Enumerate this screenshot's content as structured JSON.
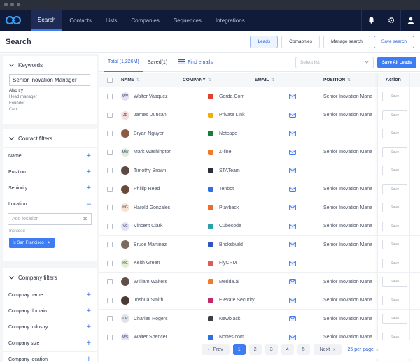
{
  "nav": {
    "tabs": [
      "Search",
      "Contacts",
      "Lists",
      "Companies",
      "Sequences",
      "Integrations"
    ],
    "active": "Search"
  },
  "header": {
    "title": "Search",
    "buttons": [
      "Leads",
      "Comapnies",
      "Manage search",
      "Save search"
    ]
  },
  "sidebar": {
    "keywords": {
      "title": "Keywords",
      "value": "Senior Inovation Manager",
      "also_try_label": "Also try",
      "suggestions": [
        "Head manager",
        "Founder",
        "Ceo"
      ]
    },
    "contact_filters": {
      "title": "Contact filters",
      "items": [
        "Name",
        "Position",
        "Seniority",
        "Location"
      ],
      "location_placeholder": "Add location",
      "included_label": "Included",
      "chip": "Is San Francisco"
    },
    "company_filters": {
      "title": "Company filters",
      "items": [
        "Compnay name",
        "Company domain",
        "Company industry",
        "Company size",
        "Company location"
      ]
    }
  },
  "main": {
    "tabs": [
      "Total (1,226M)",
      "Saved(1)"
    ],
    "find_emails": "Find emails",
    "select_placeholder": "Select list",
    "save_all": "Save All Leads",
    "columns": [
      "NAME",
      "COMPANY",
      "EMAIL",
      "POSITION",
      "Action"
    ],
    "save_label": "Save",
    "rows": [
      {
        "name": "Walter Vasquez",
        "initials": "WV",
        "avatar_color": "#e3e1f6",
        "company": "Gorda Com",
        "logo_color": "#e0412f",
        "email": true,
        "position": "Senior Inovation Mana"
      },
      {
        "name": "James Duncan",
        "initials": "JD",
        "avatar_color": "#f7dcdc",
        "company": "Private Link",
        "logo_color": "#f0b000",
        "email": true,
        "position": "Senior Inovation Mana"
      },
      {
        "name": "Bryan Nguyen",
        "initials": "",
        "avatar_color": "#8a5a44",
        "company": "Netcape",
        "logo_color": "#1a7a3a",
        "email": true,
        "position": ""
      },
      {
        "name": "Mark Washington",
        "initials": "MW",
        "avatar_color": "#dcefd6",
        "company": "Z-line",
        "logo_color": "#f07a2a",
        "email": true,
        "position": "Senior Inovation Mana"
      },
      {
        "name": "Timothy Brown",
        "initials": "",
        "avatar_color": "#5a4a42",
        "company": "STATeam",
        "logo_color": "#2a2f3a",
        "email": true,
        "position": ""
      },
      {
        "name": "Phillip Reed",
        "initials": "",
        "avatar_color": "#6b4a3a",
        "company": "Tenbot",
        "logo_color": "#2f6fe0",
        "email": true,
        "position": "Senior Inovation Mana"
      },
      {
        "name": "Harold Gonzales",
        "initials": "HG",
        "avatar_color": "#f6e2cf",
        "company": "Playback",
        "logo_color": "#f06a2a",
        "email": true,
        "position": "Senior Inovation Mana"
      },
      {
        "name": "Vincent Clark",
        "initials": "VC",
        "avatar_color": "#e3e1f6",
        "company": "Cubecode",
        "logo_color": "#2aa0a8",
        "email": true,
        "position": "Senior Inovation Mana"
      },
      {
        "name": "Bruce Martinez",
        "initials": "",
        "avatar_color": "#7a6a60",
        "company": "Bricksbuild",
        "logo_color": "#2f55c0",
        "email": true,
        "position": "Senior Inovation Mana"
      },
      {
        "name": "Keith Green",
        "initials": "KG",
        "avatar_color": "#e4efd2",
        "company": "FlyCRM",
        "logo_color": "#e05a5a",
        "email": true,
        "position": ""
      },
      {
        "name": "William Walters",
        "initials": "",
        "avatar_color": "#5f4f48",
        "company": "Merida.ai",
        "logo_color": "#f07a2a",
        "email": true,
        "position": "Senior Inovation Mana"
      },
      {
        "name": "Joshua Smith",
        "initials": "",
        "avatar_color": "#4a3a36",
        "company": "Elevate Security",
        "logo_color": "#c02a6a",
        "email": true,
        "position": "Senior Inovation Mana"
      },
      {
        "name": "Charles Rogers",
        "initials": "CR",
        "avatar_color": "#dfe3e8",
        "company": "Newblack",
        "logo_color": "#3a3f4a",
        "email": true,
        "position": "Senior Inovation Mana"
      },
      {
        "name": "Walter Spencer",
        "initials": "WS",
        "avatar_color": "#e3e1f6",
        "company": "Nortes.com",
        "logo_color": "#2f6fe0",
        "email": true,
        "position": "Senior Inovation Mana"
      }
    ],
    "pagination": {
      "prev": "Prev",
      "pages": [
        "1",
        "2",
        "3",
        "4",
        "5"
      ],
      "current": "1",
      "next": "Next",
      "per_page": "25 per page"
    }
  }
}
